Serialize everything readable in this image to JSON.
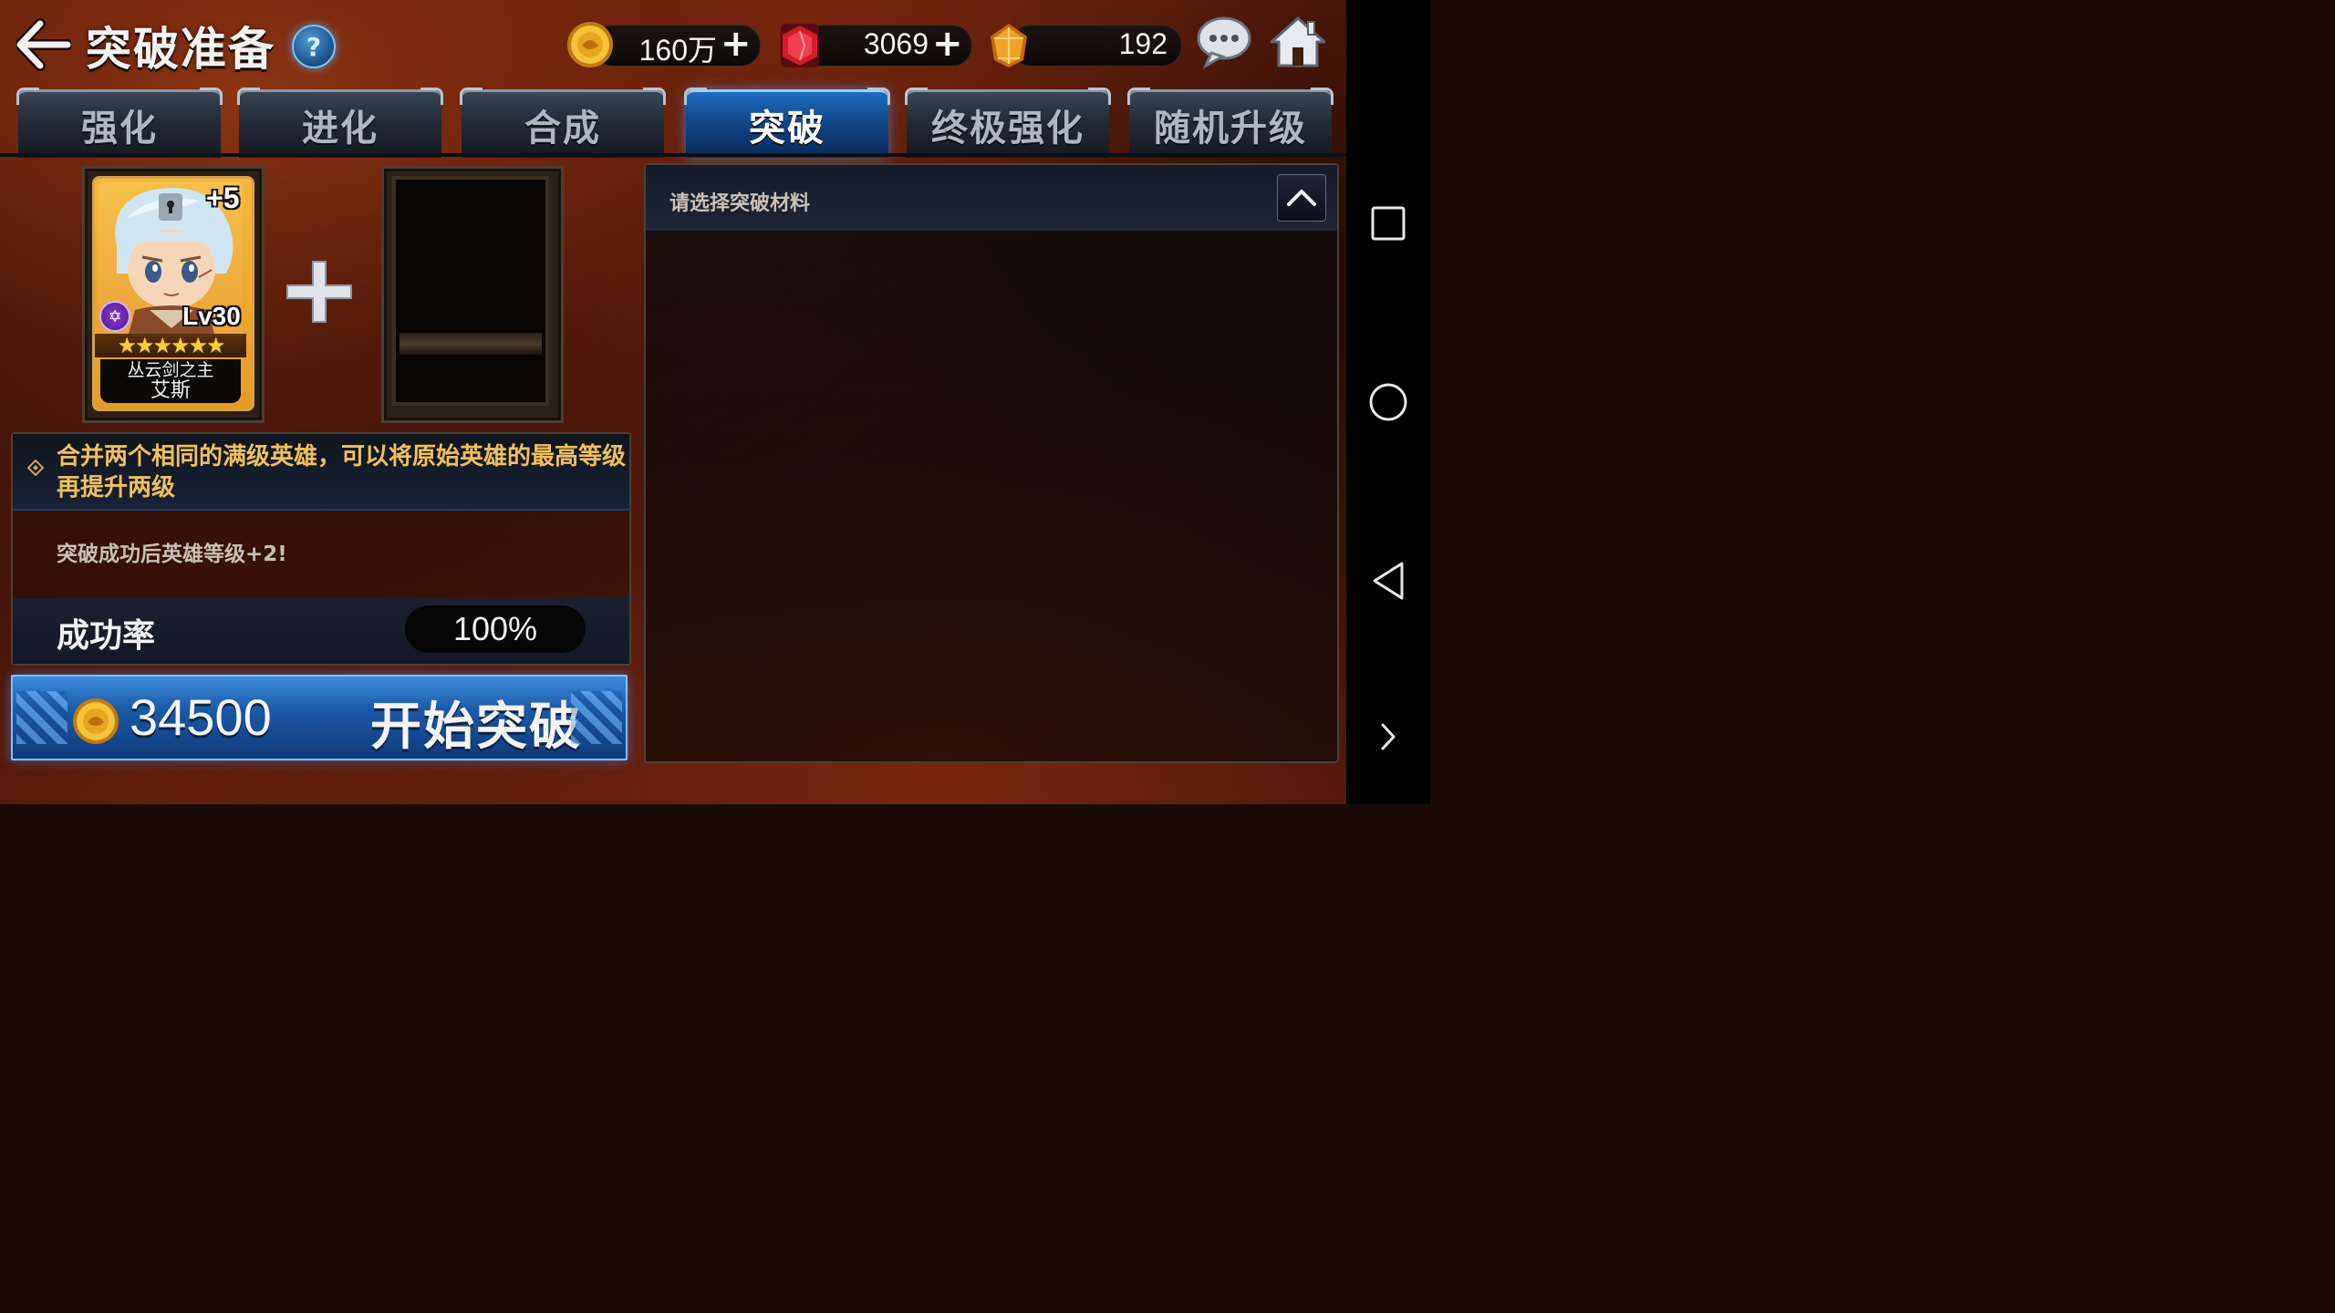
{
  "header": {
    "title": "突破准备",
    "help_label": "?"
  },
  "resources": {
    "gold": "160万",
    "ruby": "3069",
    "crystal": "192",
    "plus_symbol": "+"
  },
  "tabs": [
    {
      "label": "强化",
      "active": false
    },
    {
      "label": "进化",
      "active": false
    },
    {
      "label": "合成",
      "active": false
    },
    {
      "label": "突破",
      "active": true
    },
    {
      "label": "终极强化",
      "active": false
    },
    {
      "label": "随机升级",
      "active": false
    }
  ],
  "hero": {
    "bonus": "+5",
    "level": "Lv30",
    "stars": "★★★★★★",
    "title": "丛云剑之主",
    "name": "艾斯",
    "class_icon": "✡"
  },
  "info": {
    "description": "合并两个相同的满级英雄，可以将原始英雄的最高等级再提升两级",
    "note": "突破成功后英雄等级+2!",
    "rate_label": "成功率",
    "rate_value": "100%"
  },
  "start": {
    "cost": "34500",
    "label": "开始突破"
  },
  "material": {
    "hint": "请选择突破材料"
  },
  "colors": {
    "accent_blue": "#1a5aa8",
    "gold_text": "#f0c05a",
    "background_red": "#4a1608"
  },
  "icons": {
    "back": "back-arrow-icon",
    "gold": "gold-coin-icon",
    "ruby": "ruby-gem-icon",
    "crystal": "crystal-icon",
    "chat": "chat-bubble-icon",
    "home": "home-icon"
  }
}
